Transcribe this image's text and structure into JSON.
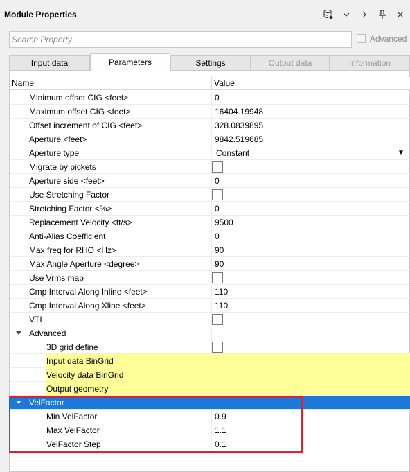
{
  "window": {
    "title": "Module Properties"
  },
  "toolbar_icons": [
    "database-settings-icon",
    "chevron-down-icon",
    "chevron-right-icon",
    "pin-icon",
    "close-icon"
  ],
  "search": {
    "placeholder": "Search Property",
    "value": ""
  },
  "advanced_toggle": {
    "label": "Advanced",
    "checked": false,
    "enabled": false
  },
  "tabs": [
    {
      "label": "Input data",
      "active": false,
      "enabled": true
    },
    {
      "label": "Parameters",
      "active": true,
      "enabled": true
    },
    {
      "label": "Settings",
      "active": false,
      "enabled": true
    },
    {
      "label": "Output data",
      "active": false,
      "enabled": false
    },
    {
      "label": "Information",
      "active": false,
      "enabled": false
    }
  ],
  "table": {
    "headers": {
      "name": "Name",
      "value": "Value"
    },
    "rows": [
      {
        "name": "Minimum offset CIG <feet>",
        "value": "0"
      },
      {
        "name": "Maximum offset CIG <feet>",
        "value": "16404.19948"
      },
      {
        "name": "Offset increment of CIG <feet>",
        "value": "328.0839895"
      },
      {
        "name": "Aperture <feet>",
        "value": "9842.519685"
      },
      {
        "name": "Aperture type",
        "value": "Constant"
      },
      {
        "name": "Migrate by pickets",
        "value": ""
      },
      {
        "name": "Aperture side <feet>",
        "value": "0"
      },
      {
        "name": "Use Stretching Factor",
        "value": ""
      },
      {
        "name": "Stretching Factor <%>",
        "value": "0"
      },
      {
        "name": "Replacement Velocity <ft/s>",
        "value": "9500"
      },
      {
        "name": "Anti-Alias Coefficient",
        "value": "0"
      },
      {
        "name": "Max freq for RHO <Hz>",
        "value": "90"
      },
      {
        "name": "Max Angle Aperture <degree>",
        "value": "90"
      },
      {
        "name": "Use Vrms map",
        "value": ""
      },
      {
        "name": "Cmp Interval Along Inline <feet>",
        "value": "110"
      },
      {
        "name": "Cmp Interval Along Xline <feet>",
        "value": "110"
      },
      {
        "name": "VTI",
        "value": ""
      },
      {
        "name": "Advanced",
        "value": ""
      },
      {
        "name": "3D grid define",
        "value": ""
      },
      {
        "name": "Input data BinGrid",
        "value": ""
      },
      {
        "name": "Velocity data BinGrid",
        "value": ""
      },
      {
        "name": "Output geometry",
        "value": ""
      },
      {
        "name": "VelFactor",
        "value": ""
      },
      {
        "name": "Min VelFactor",
        "value": "0.9"
      },
      {
        "name": "Max VelFactor",
        "value": "1.1"
      },
      {
        "name": "VelFactor Step",
        "value": "0.1"
      }
    ]
  },
  "colors": {
    "selection": "#1e78d7",
    "highlight_yellow": "#ffff99",
    "annotation_red": "#e0202a"
  }
}
